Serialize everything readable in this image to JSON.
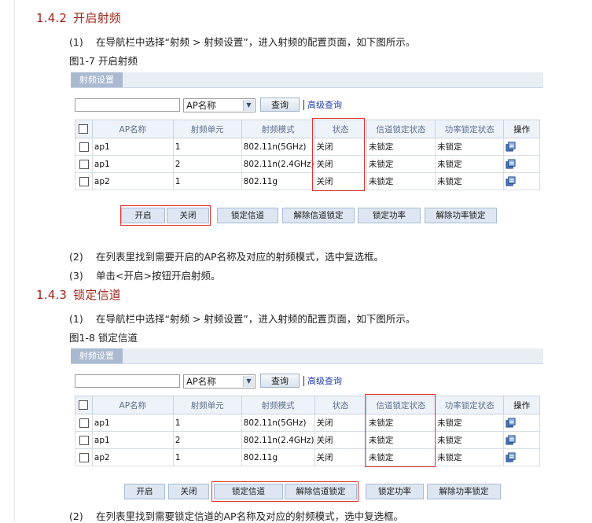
{
  "section1": {
    "number": "1.4.2",
    "title": "开启射频",
    "step1_num": "(1)",
    "step1_text": "在导航栏中选择“射频 > 射频设置”，进入射频的配置页面，如下图所示。",
    "figure_caption": "图1-7 开启射频",
    "step2_num": "(2)",
    "step2_text": "在列表里找到需要开启的AP名称及对应的射频模式，选中复选框。",
    "step3_num": "(3)",
    "step3_text": "单击<开启>按钮开启射频。"
  },
  "section2": {
    "number": "1.4.3",
    "title": "锁定信道",
    "step1_num": "(1)",
    "step1_text": "在导航栏中选择“射频 > 射频设置”，进入射频的配置页面，如下图所示。",
    "figure_caption": "图1-8 锁定信道",
    "step2_num": "(2)",
    "step2_text": "在列表里找到需要锁定信道的AP名称及对应的射频模式，选中复选框。"
  },
  "panel": {
    "tab_label": "射频设置",
    "search_value": "",
    "select_value": "AP名称",
    "query_label": "查询",
    "advanced_label": "高级查询",
    "columns": [
      "AP名称",
      "射频单元",
      "射频模式",
      "状态",
      "信道锁定状态",
      "功率锁定状态",
      "操作"
    ],
    "rows": [
      {
        "ap": "ap1",
        "unit": "1",
        "mode": "802.11n(5GHz)",
        "status": "关闭",
        "channel_lock": "未锁定",
        "power_lock": "未锁定"
      },
      {
        "ap": "ap1",
        "unit": "2",
        "mode": "802.11n(2.4GHz)",
        "status": "关闭",
        "channel_lock": "未锁定",
        "power_lock": "未锁定"
      },
      {
        "ap": "ap2",
        "unit": "1",
        "mode": "802.11g",
        "status": "关闭",
        "channel_lock": "未锁定",
        "power_lock": "未锁定"
      }
    ],
    "buttons": {
      "enable": "开启",
      "disable": "关闭",
      "lock_channel": "锁定信道",
      "unlock_channel": "解除信道锁定",
      "lock_power": "锁定功率",
      "unlock_power": "解除功率锁定"
    }
  },
  "colors": {
    "heading": "#a0261c",
    "highlight": "#e0322a",
    "link": "#1f3fa8",
    "tab": "#a9bad0"
  }
}
